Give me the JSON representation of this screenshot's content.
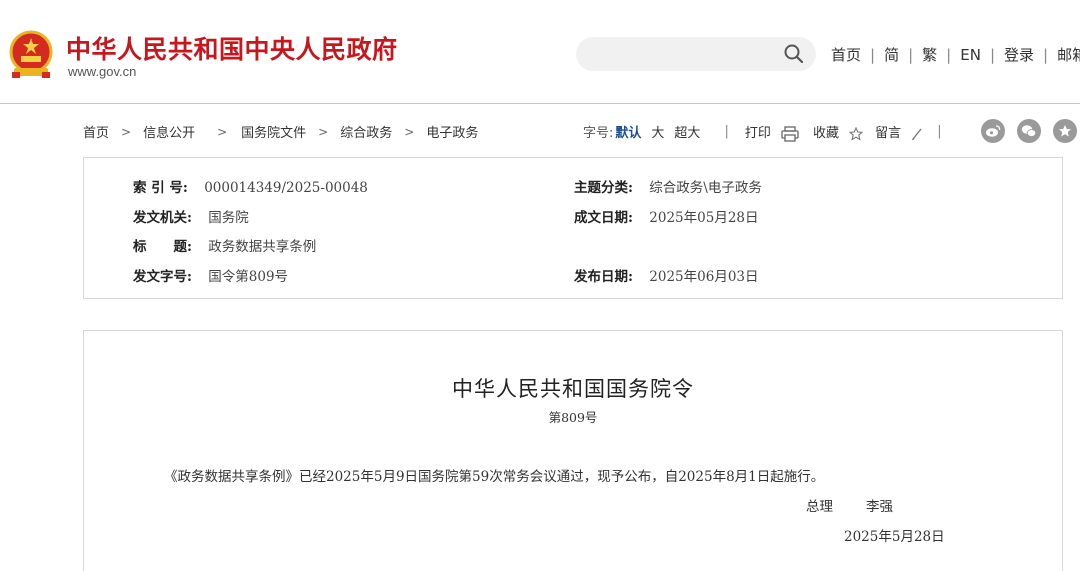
{
  "header": {
    "site_title": "中华人民共和国中央人民政府",
    "site_domain": "www.gov.cn",
    "search_placeholder": "",
    "nav": [
      "首页",
      "简",
      "繁",
      "EN",
      "登录",
      "邮箱"
    ],
    "brand_color": "#c8161d"
  },
  "breadcrumb": [
    "首页",
    "信息公开",
    "国务院文件",
    "综合政务",
    "电子政务"
  ],
  "tools": {
    "font_label": "字号:",
    "sizes": [
      "默认",
      "大",
      "超大"
    ],
    "active_size": "默认",
    "print": "打印",
    "favorite": "收藏",
    "comment": "留言",
    "share_icons": [
      "weibo-icon",
      "wechat-icon",
      "star-icon"
    ]
  },
  "info": {
    "index_key": "索 引 号:",
    "index_value": "000014349/2025-00048",
    "topic_key": "主题分类:",
    "topic_value": "综合政务\\电子政务",
    "issuer_key": "发文机关:",
    "issuer_value": "国务院",
    "date_written_key": "成文日期:",
    "date_written_value": "2025年05月28日",
    "title_key": "标　　题:",
    "title_value": "政务数据共享条例",
    "doc_no_key": "发文字号:",
    "doc_no_value": "国令第809号",
    "publish_date_key": "发布日期:",
    "publish_date_value": "2025年06月03日"
  },
  "document": {
    "title": "中华人民共和国国务院令",
    "number": "第809号",
    "body": "《政务数据共享条例》已经2025年5月9日国务院第59次常务会议通过，现予公布，自2025年8月1日起施行。",
    "sign_title": "总理",
    "sign_name": "李强",
    "sign_date": "2025年5月28日"
  }
}
